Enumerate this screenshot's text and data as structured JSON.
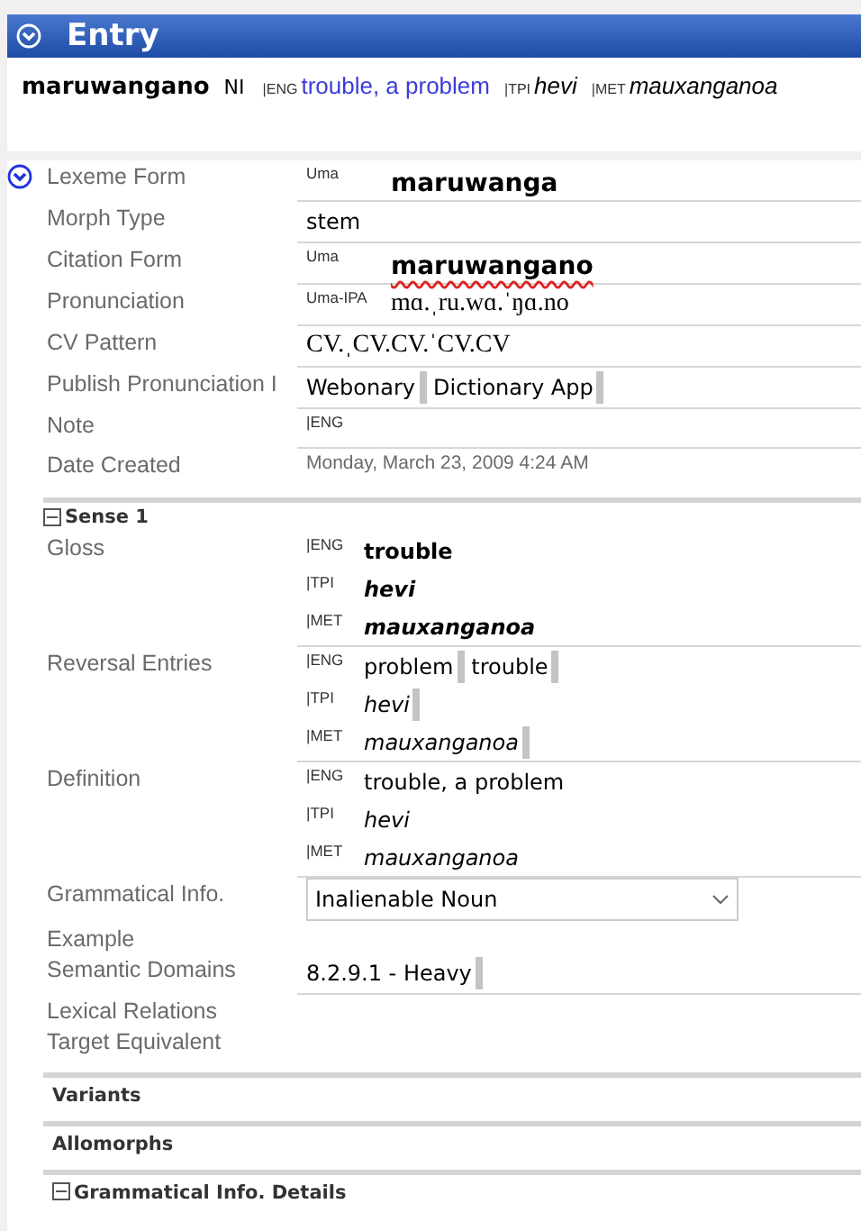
{
  "header": {
    "title": "Entry",
    "expanded": true
  },
  "summary": {
    "headword": "maruwangano",
    "pos": "NI",
    "glosses": [
      {
        "ws": "|ENG",
        "text": "trouble, a problem",
        "italic": false,
        "link": true
      },
      {
        "ws": "|TPI",
        "text": "hevi",
        "italic": true,
        "link": false
      },
      {
        "ws": "|MET",
        "text": "mauxanganoa",
        "italic": true,
        "link": false
      }
    ]
  },
  "entry_fields": [
    {
      "label": "Lexeme Form",
      "kind": "form",
      "expanded": true,
      "bold": true,
      "lines": [
        {
          "ws": "Uma",
          "text": "maruwanga"
        }
      ]
    },
    {
      "label": "Morph Type",
      "kind": "text",
      "value": "stem"
    },
    {
      "label": "Citation Form",
      "kind": "form",
      "bold": true,
      "misspelled": true,
      "lines": [
        {
          "ws": "Uma",
          "text": "maruwangano"
        }
      ]
    },
    {
      "label": "Pronunciation",
      "kind": "form",
      "bold": false,
      "serif": true,
      "lines": [
        {
          "ws": "Uma-IPA",
          "text": "mɑ.ˌru.wɑ.ˈŋɑ.no"
        }
      ]
    },
    {
      "label": "CV Pattern",
      "kind": "text",
      "serif": true,
      "value": "CV.ˌCV.CV.ˈCV.CV"
    },
    {
      "label": "Publish Pronunciation I",
      "kind": "chips",
      "chips": [
        "Webonary",
        "Dictionary App"
      ]
    },
    {
      "label": "Note",
      "kind": "multi",
      "lines": [
        {
          "ws": "|ENG"
        }
      ]
    },
    {
      "label": "Date Created",
      "kind": "date",
      "value": "Monday, March 23, 2009 4:24 AM"
    }
  ],
  "sense": {
    "title": "Sense 1",
    "expanded": true,
    "fields": [
      {
        "label": "Gloss",
        "kind": "multi",
        "bold": true,
        "lines": [
          {
            "ws": "|ENG",
            "text": "trouble",
            "italic": false
          },
          {
            "ws": "|TPI",
            "text": "hevi",
            "italic": true
          },
          {
            "ws": "|MET",
            "text": "mauxanganoa",
            "italic": true
          }
        ]
      },
      {
        "label": "Reversal Entries",
        "kind": "multi",
        "lines": [
          {
            "ws": "|ENG",
            "chips": [
              "problem",
              "trouble"
            ],
            "italic": false
          },
          {
            "ws": "|TPI",
            "chips": [
              "hevi"
            ],
            "italic": true
          },
          {
            "ws": "|MET",
            "chips": [
              "mauxanganoa"
            ],
            "italic": true
          }
        ]
      },
      {
        "label": "Definition",
        "kind": "multi",
        "lines": [
          {
            "ws": "|ENG",
            "text": "trouble, a problem",
            "italic": false
          },
          {
            "ws": "|TPI",
            "text": "hevi",
            "italic": true
          },
          {
            "ws": "|MET",
            "text": "mauxanganoa",
            "italic": true
          }
        ]
      },
      {
        "label": "Grammatical Info.",
        "kind": "dropdown",
        "value": "Inalienable Noun"
      },
      {
        "label": "Example",
        "kind": "empty"
      },
      {
        "label": "Semantic Domains",
        "kind": "chips",
        "chips": [
          "8.2.9.1 - Heavy"
        ]
      },
      {
        "label": "Lexical Relations",
        "kind": "empty"
      },
      {
        "label": "Target Equivalent",
        "kind": "empty"
      }
    ]
  },
  "sections": [
    {
      "title": "Variants"
    },
    {
      "title": "Allomorphs"
    },
    {
      "title": "Grammatical Info. Details",
      "expanded": true
    }
  ]
}
